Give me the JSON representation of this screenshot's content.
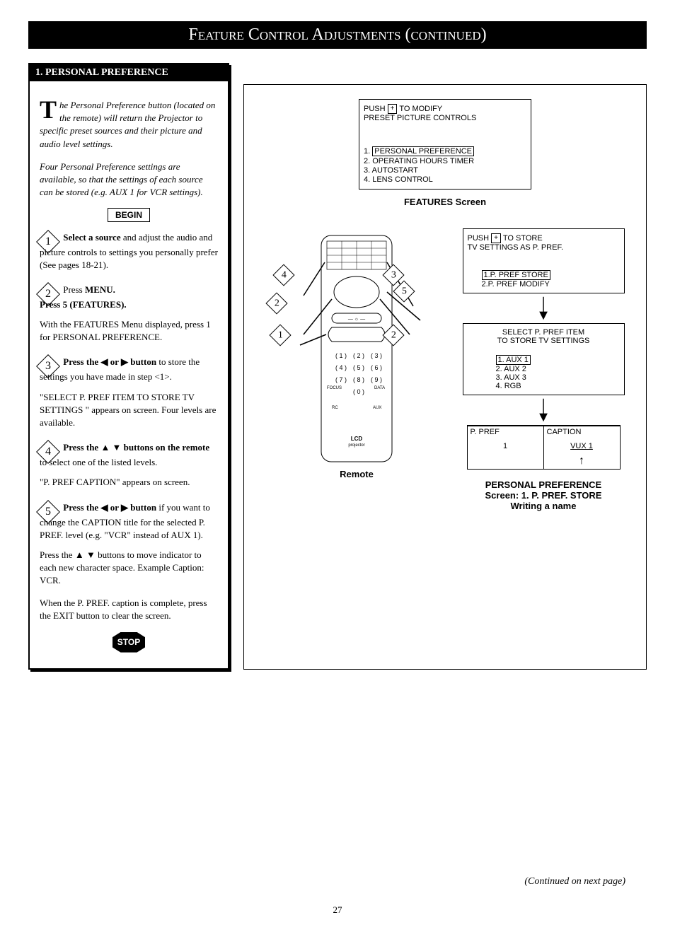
{
  "header": {
    "title": "Feature Control Adjustments (continued)"
  },
  "left": {
    "section_title": "1. PERSONAL PREFERENCE",
    "intro1": "he Personal Preference button (located on the remote) will return the Projector to specific preset sources and their picture and audio level settings.",
    "intro_dropcap": "T",
    "intro2": "Four Personal Preference settings are available, so that the settings of each source can be stored (e.g. AUX 1 for VCR settings).",
    "begin": "BEGIN",
    "step1_bold": "Select a source",
    "step1_rest": " and adjust the audio and picture controls to settings you personally prefer (See pages 18-21).",
    "step2_line1_a": "Press ",
    "step2_line1_b": "MENU.",
    "step2_line2": "Press 5 (FEATURES).",
    "step2_body": "With the FEATURES Menu displayed, press 1 for PERSONAL PREFERENCE.",
    "step3_bold": "Press the ◀ or ▶ button",
    "step3_rest": " to store the settings you have made in step <1>.",
    "step3_body": "\"SELECT P. PREF ITEM TO STORE TV SETTINGS \" appears on screen. Four levels are available.",
    "step4_bold": "Press the ▲ ▼ buttons on the remote",
    "step4_rest": " to select one of the listed levels.",
    "step4_body": "\"P. PREF CAPTION\" appears on screen.",
    "step5_bold": "Press the ◀ or ▶ button",
    "step5_rest": " if you want to change the CAPTION title for the selected P. PREF. level (e.g. \"VCR\" instead of AUX 1).",
    "step5_body1": "Press the ▲ ▼ buttons to move indicator to each new character space. Example Caption: VCR.",
    "step5_body2": "When the P. PREF. caption is complete, press the EXIT button to clear the screen.",
    "stop": "STOP"
  },
  "right": {
    "features_screen": {
      "top1": "PUSH ",
      "top_plus": "+",
      "top2": " TO MODIFY",
      "top3": "PRESET PICTURE CONTROLS",
      "items": [
        "1. PERSONAL PREFERENCE",
        "2. OPERATING HOURS TIMER",
        "3. AUTOSTART",
        "4. LENS CONTROL"
      ],
      "item1_text": "PERSONAL PREFERENCE",
      "label": "FEATURES Screen"
    },
    "remote_label": "Remote",
    "pp_screen1": {
      "top1": "PUSH ",
      "top_plus": "+",
      "top2": " TO STORE",
      "top3": "TV SETTINGS AS P. PREF.",
      "item1": "1.P. PREF STORE",
      "item2": "2.P. PREF MODIFY"
    },
    "pp_screen2": {
      "line1": "SELECT P. PREF ITEM",
      "line2": "TO STORE TV SETTINGS",
      "item1": "1. AUX 1",
      "item2": "2. AUX 2",
      "item3": "3. AUX 3",
      "item4": "4. RGB"
    },
    "pp_screen3": {
      "col1_h": "P. PREF",
      "col1_v": "1",
      "col2_h": "CAPTION",
      "col2_v": "VUX 1"
    },
    "pp_label_1": "PERSONAL PREFERENCE",
    "pp_label_2": "Screen: 1. P. PREF. STORE",
    "pp_label_3": "Writing a name"
  },
  "footer": {
    "continued": "(Continued on next page)",
    "page_num": "27"
  }
}
